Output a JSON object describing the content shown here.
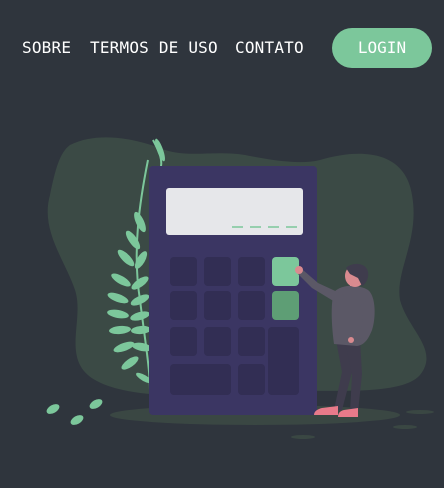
{
  "nav": {
    "links": [
      {
        "label": "SOBRE"
      },
      {
        "label": "TERMOS DE USO"
      },
      {
        "label": "CONTATO"
      }
    ],
    "login_label": "LOGIN"
  },
  "colors": {
    "background": "#2f353d",
    "accent": "#7cc79b",
    "calculator": "#3b3663",
    "blob": "#3b4a45"
  },
  "illustration": {
    "name": "person-pressing-calculator"
  }
}
